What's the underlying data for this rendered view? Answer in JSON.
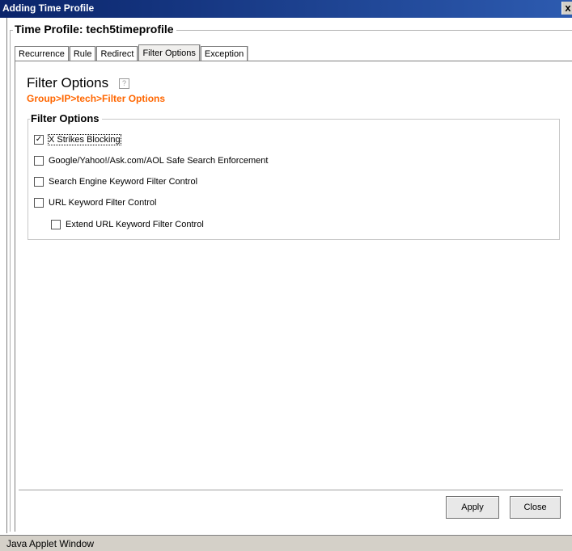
{
  "window": {
    "title": "Adding Time Profile",
    "close_glyph": "x"
  },
  "profile": {
    "title": "Time Profile: tech5timeprofile"
  },
  "tabs": [
    {
      "label": "Recurrence"
    },
    {
      "label": "Rule"
    },
    {
      "label": "Redirect"
    },
    {
      "label": "Filter Options",
      "active": true
    },
    {
      "label": "Exception"
    }
  ],
  "panel": {
    "heading": "Filter Options",
    "help_glyph": "?",
    "breadcrumb": "Group>IP>tech>Filter Options"
  },
  "filter_box": {
    "legend": "Filter Options",
    "options": [
      {
        "label": "X Strikes Blocking",
        "checked": true
      },
      {
        "label": "Google/Yahoo!/Ask.com/AOL Safe Search Enforcement",
        "checked": false
      },
      {
        "label": "Search Engine Keyword Filter Control",
        "checked": false
      },
      {
        "label": "URL Keyword Filter Control",
        "checked": false
      },
      {
        "label": "Extend URL Keyword Filter Control",
        "checked": false
      }
    ]
  },
  "buttons": {
    "apply": "Apply",
    "close": "Close"
  },
  "status": {
    "text": "Java Applet Window"
  },
  "colors": {
    "titlebar": "#0a246a",
    "breadcrumb": "#ff6600",
    "status_bg": "#d4d0c8"
  }
}
